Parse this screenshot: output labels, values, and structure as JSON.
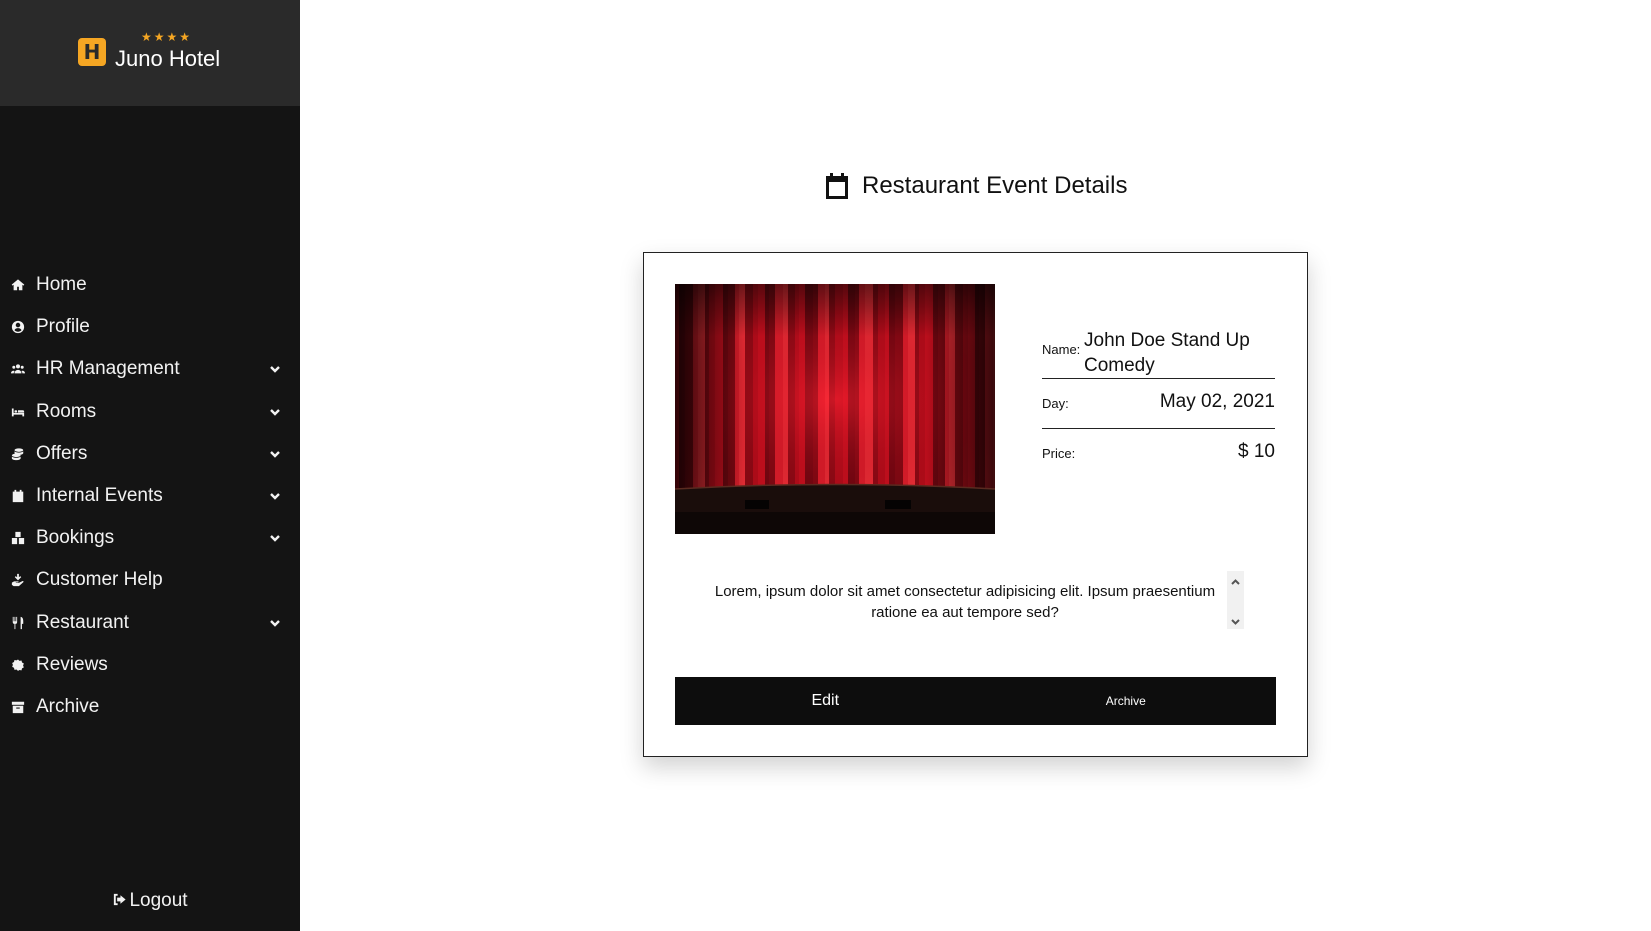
{
  "brand": {
    "name": "Juno Hotel",
    "logo_letter": "H",
    "stars": "★★★★"
  },
  "sidebar": {
    "items": [
      {
        "label": "Home",
        "icon": "home-icon",
        "has_submenu": false
      },
      {
        "label": "Profile",
        "icon": "user-circle-icon",
        "has_submenu": false
      },
      {
        "label": "HR Management",
        "icon": "users-icon",
        "has_submenu": true
      },
      {
        "label": "Rooms",
        "icon": "bed-icon",
        "has_submenu": true
      },
      {
        "label": "Offers",
        "icon": "coins-icon",
        "has_submenu": true
      },
      {
        "label": "Internal Events",
        "icon": "calendar-icon",
        "has_submenu": true
      },
      {
        "label": "Bookings",
        "icon": "boxes-icon",
        "has_submenu": true
      },
      {
        "label": "Customer Help",
        "icon": "hand-holding-icon",
        "has_submenu": false
      },
      {
        "label": "Restaurant",
        "icon": "utensils-icon",
        "has_submenu": true
      },
      {
        "label": "Reviews",
        "icon": "badge-icon",
        "has_submenu": false
      },
      {
        "label": "Archive",
        "icon": "archive-icon",
        "has_submenu": false
      }
    ],
    "logout_label": "Logout"
  },
  "main": {
    "title": "Restaurant Event Details",
    "title_icon": "calendar-icon"
  },
  "event": {
    "image": "red-stage-curtain",
    "name_label": "Name:",
    "name": "John Doe Stand Up Comedy",
    "day_label": "Day:",
    "day": "May 02, 2021",
    "price_label": "Price:",
    "price": "$ 10",
    "description": "Lorem, ipsum dolor sit amet consectetur adipisicing elit. Ipsum praesentium ratione ea aut tempore sed?"
  },
  "actions": {
    "edit_label": "Edit",
    "archive_label": "Archive"
  },
  "colors": {
    "sidebar_bg": "#141414",
    "brand_bg": "#2a2a2a",
    "accent": "#f5a623",
    "button_bg": "#0d0d0d"
  }
}
